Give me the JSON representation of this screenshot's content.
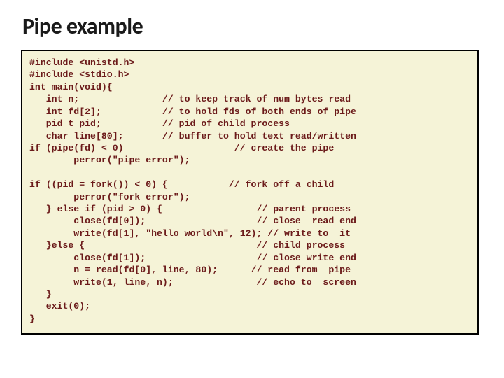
{
  "slide": {
    "title": "Pipe example",
    "code": "#include <unistd.h>\n#include <stdio.h>\nint main(void){\n   int n;               // to keep track of num bytes read\n   int fd[2];           // to hold fds of both ends of pipe\n   pid_t pid;           // pid of child process\n   char line[80];       // buffer to hold text read/written\nif (pipe(fd) < 0)                    // create the pipe\n        perror(\"pipe error\");\n\nif ((pid = fork()) < 0) {           // fork off a child\n        perror(\"fork error\");\n   } else if (pid > 0) {                 // parent process\n        close(fd[0]);                    // close  read end\n        write(fd[1], \"hello world\\n\", 12); // write to  it\n   }else {                               // child process\n        close(fd[1]);                    // close write end\n        n = read(fd[0], line, 80);      // read from  pipe\n        write(1, line, n);               // echo to  screen\n   }\n   exit(0);\n}"
  }
}
